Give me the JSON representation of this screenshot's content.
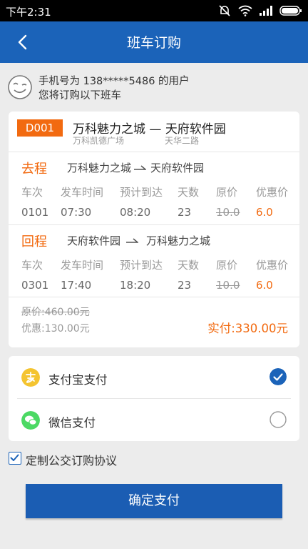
{
  "status_bar": {
    "time": "下午2:31"
  },
  "nav": {
    "title": "班车订购"
  },
  "user": {
    "line1": "手机号为 138*****5486 的用户",
    "line2": "您将订购以下班车"
  },
  "route": {
    "code": "D001",
    "from": "万科魅力之城",
    "dash": "—",
    "to": "天府软件园",
    "from_sub": "万科凯德广场",
    "to_sub": "天华二路"
  },
  "columns": [
    "车次",
    "发车时间",
    "预计到达",
    "天数",
    "原价",
    "优惠价"
  ],
  "outbound": {
    "label": "去程",
    "from": "万科魅力之城",
    "to": "天府软件园",
    "row": [
      "0101",
      "07:30",
      "08:20",
      "23",
      "10.0",
      "6.0"
    ]
  },
  "return": {
    "label": "回程",
    "from": "天府软件园",
    "to": "万科魅力之城",
    "row": [
      "0301",
      "17:40",
      "18:20",
      "23",
      "10.0",
      "6.0"
    ]
  },
  "summary": {
    "original": "原价:460.00元",
    "discount": "优惠:130.00元",
    "paid": "实付:330.00元"
  },
  "payment": {
    "options": [
      {
        "label": "支付宝支付",
        "selected": true
      },
      {
        "label": "微信支付",
        "selected": false
      }
    ]
  },
  "agreement": {
    "label": "定制公交订购协议",
    "checked": true
  },
  "confirm_label": "确定支付",
  "colors": {
    "primary": "#1b63b9",
    "accent": "#f26a10",
    "alipay": "#f4c430",
    "wechat": "#4cd964"
  }
}
